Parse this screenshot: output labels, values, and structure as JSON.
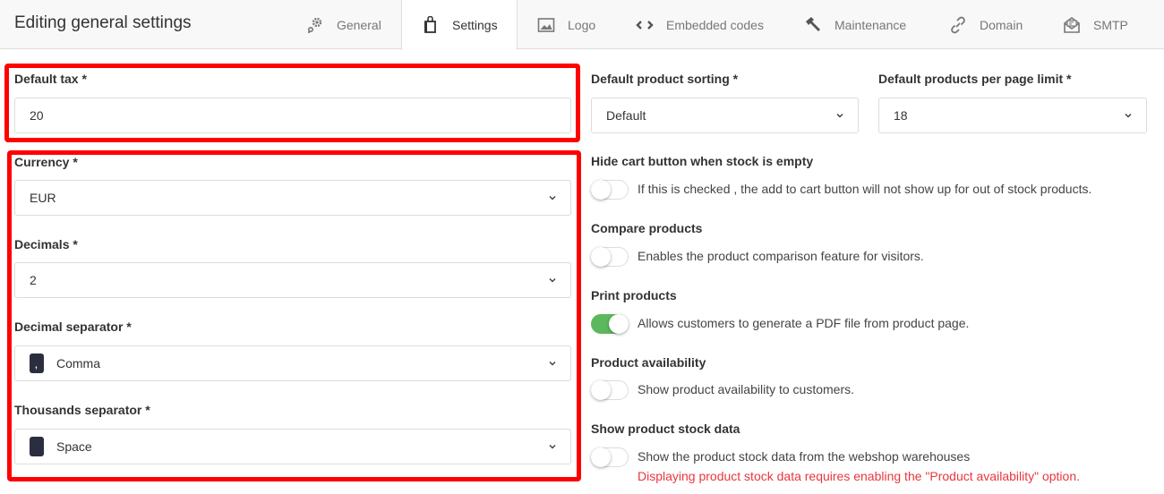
{
  "header": {
    "title": "Editing general settings",
    "tabs": [
      {
        "label": "General",
        "icon": "gears-icon",
        "active": false
      },
      {
        "label": "Settings",
        "icon": "shopping-bag-icon",
        "active": true
      },
      {
        "label": "Logo",
        "icon": "image-icon",
        "active": false
      },
      {
        "label": "Embedded codes",
        "icon": "code-icon",
        "active": false
      },
      {
        "label": "Maintenance",
        "icon": "hammer-icon",
        "active": false
      },
      {
        "label": "Domain",
        "icon": "link-icon",
        "active": false
      },
      {
        "label": "SMTP",
        "icon": "envelope-open-icon",
        "active": false
      }
    ]
  },
  "left": {
    "default_tax": {
      "label": "Default tax *",
      "value": "20"
    },
    "currency": {
      "label": "Currency *",
      "value": "EUR"
    },
    "decimals": {
      "label": "Decimals *",
      "value": "2"
    },
    "decimal_separator": {
      "label": "Decimal separator *",
      "value": "Comma",
      "symbol": ","
    },
    "thousands_separator": {
      "label": "Thousands separator *",
      "value": "Space",
      "symbol": ""
    }
  },
  "right": {
    "product_sorting": {
      "label": "Default product sorting *",
      "value": "Default"
    },
    "per_page_limit": {
      "label": "Default products per page limit *",
      "value": "18"
    },
    "toggles": [
      {
        "label": "Hide cart button when stock is empty",
        "description": "If this is checked , the add to cart button will not show up for out of stock products.",
        "checked": false
      },
      {
        "label": "Compare products",
        "description": "Enables the product comparison feature for visitors.",
        "checked": false
      },
      {
        "label": "Print products",
        "description": "Allows customers to generate a PDF file from product page.",
        "checked": true
      },
      {
        "label": "Product availability",
        "description": "Show product availability to customers.",
        "checked": false
      },
      {
        "label": "Show product stock data",
        "description": "Show the product stock data from the webshop warehouses",
        "checked": false,
        "warning": "Displaying product stock data requires enabling the \"Product availability\" option."
      }
    ]
  },
  "colors": {
    "highlight": "#ff0000",
    "toggle_on": "#5cb85c",
    "warning": "#e8373d"
  }
}
